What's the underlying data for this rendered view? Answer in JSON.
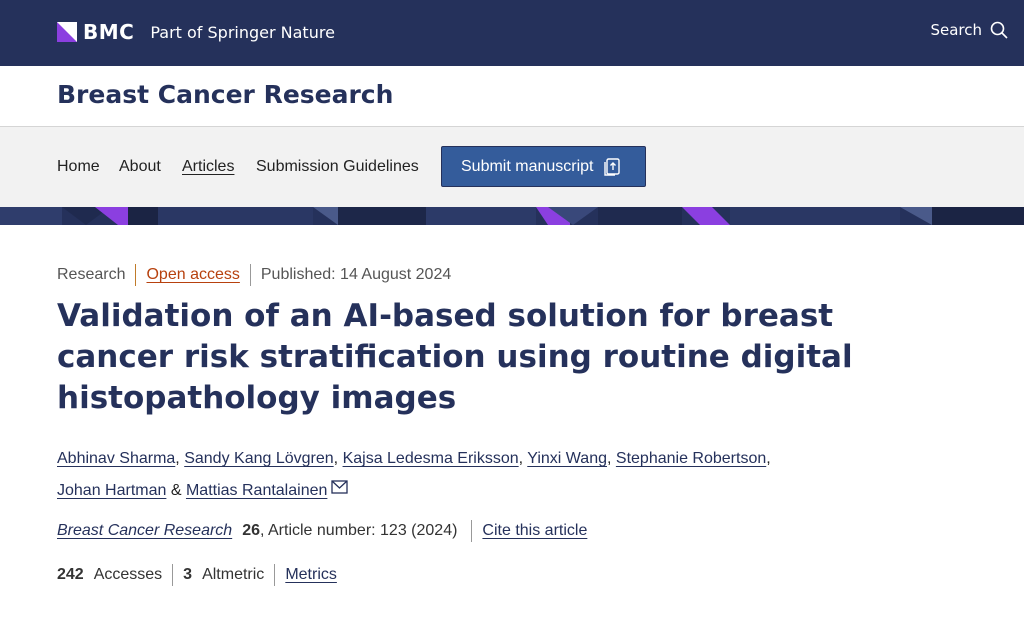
{
  "header": {
    "brand_name": "BMC",
    "brand_tagline": "Part of Springer Nature",
    "search_label": "Search"
  },
  "journal": {
    "title": "Breast Cancer Research"
  },
  "nav": {
    "items": [
      {
        "label": "Home"
      },
      {
        "label": "About"
      },
      {
        "label": "Articles"
      },
      {
        "label": "Submission Guidelines"
      }
    ],
    "active": "Articles",
    "submit_label": "Submit manuscript"
  },
  "article": {
    "type": "Research",
    "access": "Open access",
    "published": "Published: 14 August 2024",
    "title": "Validation of an AI-based solution for breast cancer risk stratification using routine digital histopathology images",
    "authors": [
      "Abhinav Sharma",
      "Sandy Kang Lövgren",
      "Kajsa Ledesma Eriksson",
      "Yinxi Wang",
      "Stephanie Robertson",
      "Johan Hartman",
      "Mattias Rantalainen"
    ],
    "author_separator": ",",
    "author_ampersand": "&",
    "citation": {
      "journal": "Breast Cancer Research",
      "volume": "26",
      "details": ", Article number: 123 (2024)",
      "cite_label": "Cite this article"
    },
    "metrics": {
      "accesses_value": "242",
      "accesses_label": "Accesses",
      "altmetric_value": "3",
      "altmetric_label": "Altmetric",
      "metrics_label": "Metrics"
    }
  },
  "colors": {
    "navy": "#25315b",
    "button_blue": "#345c9b",
    "accent_purple": "#8b3fe0",
    "open_access_orange": "#b7410e"
  }
}
